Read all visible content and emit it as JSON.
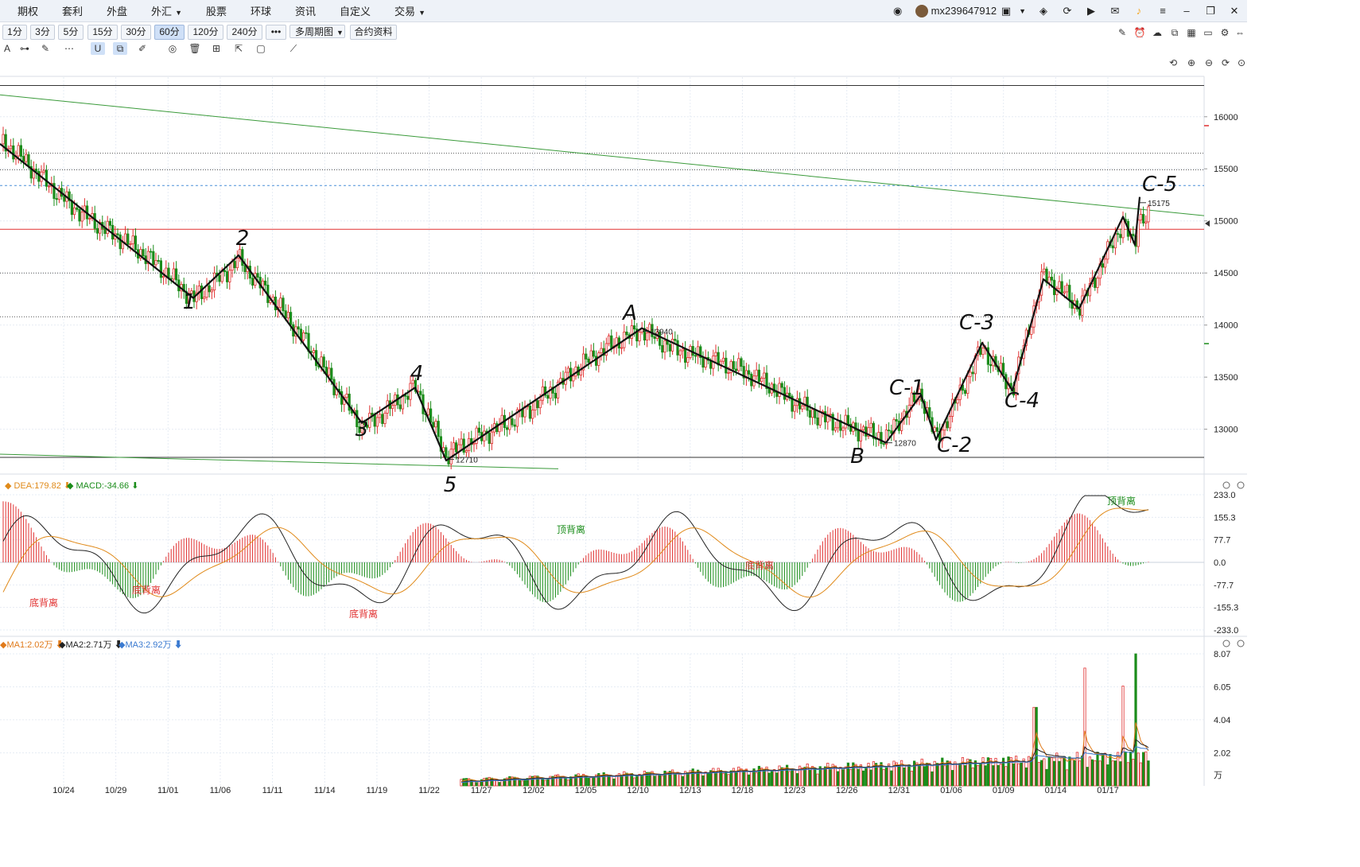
{
  "nav": {
    "items": [
      {
        "label": "期权",
        "caret": false
      },
      {
        "label": "套利",
        "caret": false
      },
      {
        "label": "外盘",
        "caret": false
      },
      {
        "label": "外汇",
        "caret": true
      },
      {
        "label": "股票",
        "caret": false
      },
      {
        "label": "环球",
        "caret": false
      },
      {
        "label": "资讯",
        "caret": false
      },
      {
        "label": "自定义",
        "caret": false
      },
      {
        "label": "交易",
        "caret": true
      }
    ],
    "username": "mx239647912"
  },
  "periods": [
    "1分",
    "3分",
    "5分",
    "15分",
    "30分",
    "60分",
    "120分",
    "240分",
    "•••",
    "多周期图",
    "合约资料"
  ],
  "active_period": "60分",
  "colors": {
    "up": "#e03030",
    "down": "#1a8c1a",
    "trend": "#3a9a3a",
    "refline": "#e03030",
    "dif": "#222222",
    "dea": "#e08a1a",
    "ma1": "#e07a1a",
    "ma2": "#222222",
    "ma3": "#3a7ad0"
  },
  "chart_data": [
    {
      "type": "candlestick",
      "panel": "price",
      "yaxis_ticks": [
        "16000",
        "15500",
        "15000",
        "14500",
        "14000",
        "13500",
        "13000"
      ],
      "ylim": [
        12600,
        16380
      ],
      "xaxis_ticks": [
        "10/24",
        "10/29",
        "11/01",
        "11/06",
        "11/11",
        "11/14",
        "11/19",
        "11/22",
        "11/27",
        "12/02",
        "12/05",
        "12/10",
        "12/13",
        "12/18",
        "12/23",
        "12/26",
        "12/31",
        "01/06",
        "01/09",
        "01/14",
        "01/17"
      ],
      "horizontal_levels": [
        16300,
        15650,
        15490,
        15340,
        14920,
        14500,
        14080,
        12730
      ],
      "annotations": [
        {
          "text": "12710",
          "price": 12710
        },
        {
          "text": "13940",
          "price": 13940
        },
        {
          "text": "12870",
          "price": 12870
        },
        {
          "text": "15175",
          "price": 15175
        }
      ],
      "wave_labels": [
        "1",
        "2",
        "3",
        "4",
        "5",
        "A",
        "B",
        "C-1",
        "C-2",
        "C-3",
        "C-4",
        "C-5"
      ],
      "wave_path_prices": [
        15740,
        14260,
        14670,
        13060,
        13400,
        12700,
        13970,
        12870,
        13330,
        12900,
        13830,
        13370,
        14440,
        14160,
        15040,
        14770,
        15230
      ]
    },
    {
      "type": "line",
      "panel": "macd",
      "legend": [
        {
          "text": "DEA:179.82",
          "color": "#e08a1a"
        },
        {
          "text": "MACD:-34.66",
          "color": "#1a8c1a"
        }
      ],
      "yaxis_ticks": [
        "233.0",
        "155.3",
        "77.7",
        "0.0",
        "-77.7",
        "-155.3",
        "-233.0"
      ],
      "ylim": [
        -233,
        233
      ],
      "annotations": [
        "底背离",
        "底背离",
        "底背离",
        "顶背离",
        "底背离",
        "顶背离"
      ]
    },
    {
      "type": "bar",
      "panel": "volume",
      "legend": [
        {
          "text": "MA1:2.02万",
          "color": "#e07a1a"
        },
        {
          "text": "MA2:2.71万",
          "color": "#222222"
        },
        {
          "text": "MA3:2.92万",
          "color": "#3a7ad0"
        }
      ],
      "yaxis_ticks": [
        "8.07",
        "6.05",
        "4.04",
        "2.02"
      ],
      "unit": "万",
      "ylim": [
        0,
        8.07
      ]
    }
  ]
}
